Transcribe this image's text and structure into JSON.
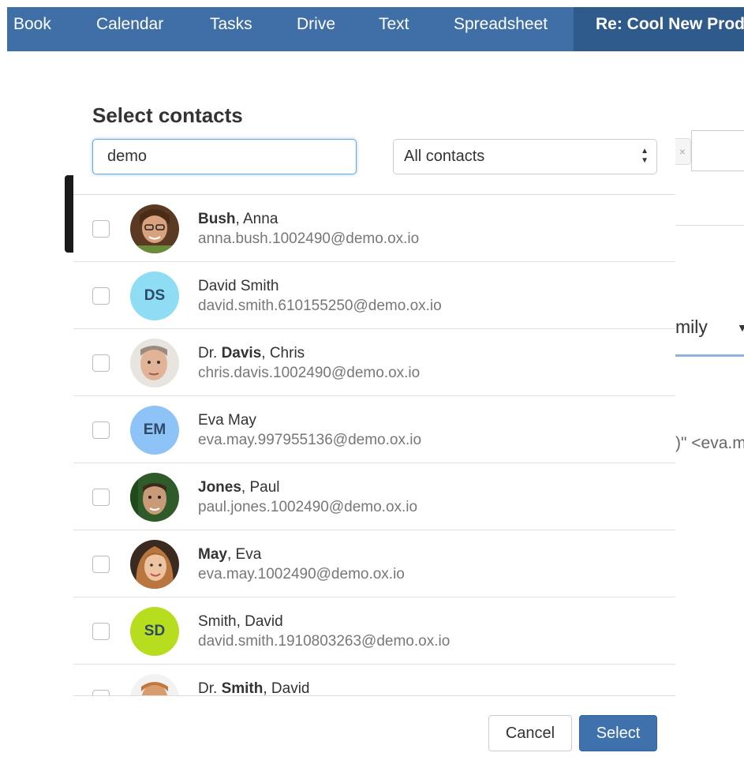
{
  "topbar": {
    "tabs": [
      "Book",
      "Calendar",
      "Tasks",
      "Drive",
      "Text",
      "Spreadsheet"
    ],
    "active_tab": "Re: Cool New Prod"
  },
  "background": {
    "select_text": "mily",
    "email_fragment": ")\" <eva.m",
    "clear_glyph": "×"
  },
  "modal": {
    "title": "Select contacts",
    "search_value": "demo",
    "filter_value": "All contacts",
    "contacts": [
      {
        "prefix": "",
        "last": "Bush",
        "rest": ", Anna",
        "email": "anna.bush.1002490@demo.ox.io",
        "avatar": "photo",
        "initials": ""
      },
      {
        "prefix": "",
        "last": "",
        "rest": "David Smith",
        "email": "david.smith.610155250@demo.ox.io",
        "avatar": "initials",
        "initials": "DS",
        "color": "#8fdcf5"
      },
      {
        "prefix": "Dr. ",
        "last": "Davis",
        "rest": ", Chris",
        "email": "chris.davis.1002490@demo.ox.io",
        "avatar": "photo",
        "initials": ""
      },
      {
        "prefix": "",
        "last": "",
        "rest": "Eva May",
        "email": "eva.may.997955136@demo.ox.io",
        "avatar": "initials",
        "initials": "EM",
        "color": "#8dc3f7"
      },
      {
        "prefix": "",
        "last": "Jones",
        "rest": ", Paul",
        "email": "paul.jones.1002490@demo.ox.io",
        "avatar": "photo",
        "initials": ""
      },
      {
        "prefix": "",
        "last": "May",
        "rest": ", Eva",
        "email": "eva.may.1002490@demo.ox.io",
        "avatar": "photo",
        "initials": ""
      },
      {
        "prefix": "",
        "last": "",
        "rest": "Smith, David",
        "email": "david.smith.1910803263@demo.ox.io",
        "avatar": "initials",
        "initials": "SD",
        "color": "#b7de1e"
      },
      {
        "prefix": "Dr. ",
        "last": "Smith",
        "rest": ", David",
        "email": "",
        "avatar": "photo",
        "initials": ""
      }
    ],
    "cancel_label": "Cancel",
    "select_label": "Select"
  }
}
